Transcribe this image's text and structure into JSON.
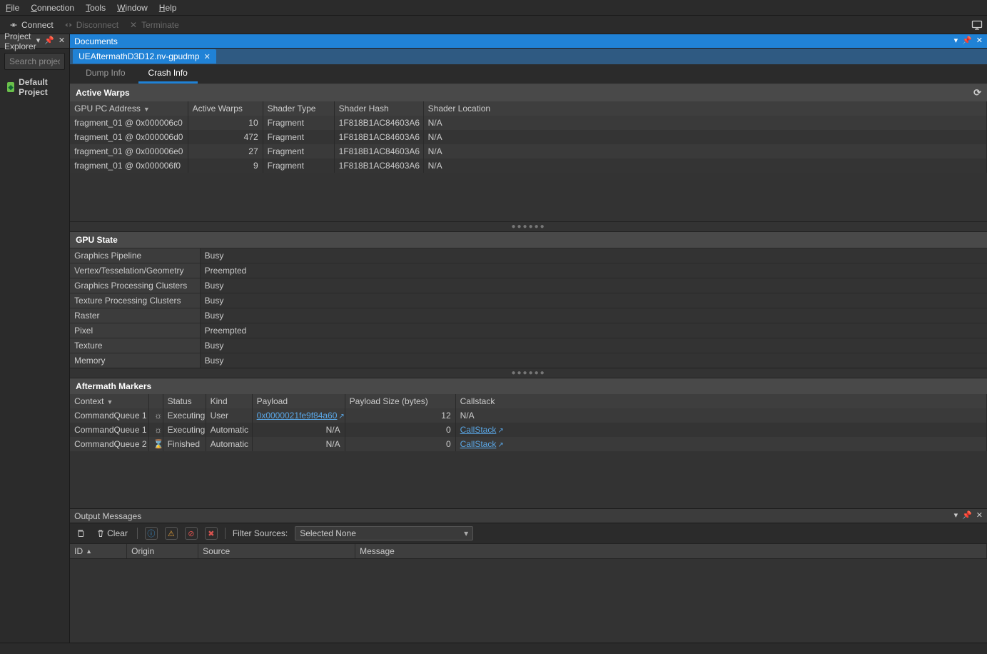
{
  "menus": {
    "file": "File",
    "connection": "Connection",
    "tools": "Tools",
    "window": "Window",
    "help": "Help"
  },
  "toolbar": {
    "connect": "Connect",
    "disconnect": "Disconnect",
    "terminate": "Terminate"
  },
  "explorer": {
    "title": "Project Explorer",
    "search_placeholder": "Search project...",
    "root": "Default Project"
  },
  "documents": {
    "title": "Documents",
    "tab_label": "UEAftermathD3D12.nv-gpudmp",
    "inner_tabs": {
      "dump": "Dump Info",
      "crash": "Crash Info"
    }
  },
  "active_warps": {
    "title": "Active Warps",
    "columns": [
      "GPU PC Address",
      "Active Warps",
      "Shader Type",
      "Shader Hash",
      "Shader Location"
    ],
    "rows": [
      {
        "addr": "fragment_01 @ 0x000006c0",
        "warps": 10,
        "stype": "Fragment",
        "hash": "1F818B1AC84603A6",
        "loc": "N/A"
      },
      {
        "addr": "fragment_01 @ 0x000006d0",
        "warps": 472,
        "stype": "Fragment",
        "hash": "1F818B1AC84603A6",
        "loc": "N/A"
      },
      {
        "addr": "fragment_01 @ 0x000006e0",
        "warps": 27,
        "stype": "Fragment",
        "hash": "1F818B1AC84603A6",
        "loc": "N/A"
      },
      {
        "addr": "fragment_01 @ 0x000006f0",
        "warps": 9,
        "stype": "Fragment",
        "hash": "1F818B1AC84603A6",
        "loc": "N/A"
      }
    ]
  },
  "gpu_state": {
    "title": "GPU State",
    "rows": [
      {
        "k": "Graphics Pipeline",
        "v": "Busy"
      },
      {
        "k": "Vertex/Tesselation/Geometry",
        "v": "Preempted"
      },
      {
        "k": "Graphics Processing Clusters",
        "v": "Busy"
      },
      {
        "k": "Texture Processing Clusters",
        "v": "Busy"
      },
      {
        "k": "Raster",
        "v": "Busy"
      },
      {
        "k": "Pixel",
        "v": "Preempted"
      },
      {
        "k": "Texture",
        "v": "Busy"
      },
      {
        "k": "Memory",
        "v": "Busy"
      }
    ]
  },
  "markers": {
    "title": "Aftermath Markers",
    "columns": [
      "Context",
      "",
      "Status",
      "Kind",
      "Payload",
      "Payload Size (bytes)",
      "Callstack"
    ],
    "rows": [
      {
        "ctx": "CommandQueue 1",
        "ico": "gear",
        "status": "Executing",
        "kind": "User",
        "payload": "0x0000021fe9f84a60",
        "payload_link": true,
        "size": 12,
        "callstack": "N/A",
        "cs_link": false
      },
      {
        "ctx": "CommandQueue 1",
        "ico": "gear",
        "status": "Executing",
        "kind": "Automatic",
        "payload": "N/A",
        "payload_link": false,
        "size": 0,
        "callstack": "CallStack",
        "cs_link": true
      },
      {
        "ctx": "CommandQueue 2",
        "ico": "hourglass",
        "status": "Finished",
        "kind": "Automatic",
        "payload": "N/A",
        "payload_link": false,
        "size": 0,
        "callstack": "CallStack",
        "cs_link": true
      }
    ]
  },
  "output": {
    "title": "Output Messages",
    "clear": "Clear",
    "filter_label": "Filter Sources:",
    "filter_value": "Selected None",
    "columns": [
      "ID",
      "Origin",
      "Source",
      "Message"
    ]
  }
}
